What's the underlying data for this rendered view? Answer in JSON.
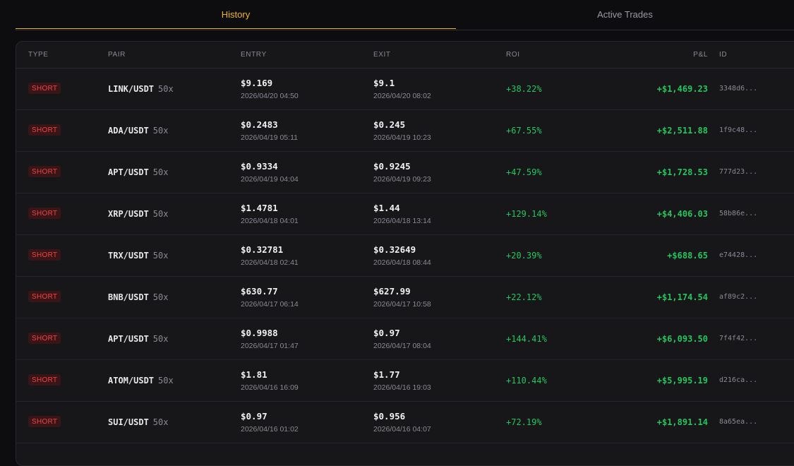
{
  "tabs": [
    {
      "label": "History",
      "active": true
    },
    {
      "label": "Active Trades",
      "active": false
    }
  ],
  "columns": {
    "type": "TYPE",
    "pair": "PAIR",
    "entry": "ENTRY",
    "exit": "EXIT",
    "roi": "ROI",
    "pnl": "P&L",
    "id": "ID"
  },
  "colors": {
    "accent": "#f0b429",
    "short": "#ef4444",
    "profit": "#22c55e"
  },
  "trades": [
    {
      "type": "SHORT",
      "pair": "LINK/USDT",
      "leverage": "50x",
      "entry_price": "$9.169",
      "entry_time": "2026/04/20 04:50",
      "exit_price": "$9.1",
      "exit_time": "2026/04/20 08:02",
      "roi": "+38.22%",
      "pnl": "+$1,469.23",
      "id": "3348d6..."
    },
    {
      "type": "SHORT",
      "pair": "ADA/USDT",
      "leverage": "50x",
      "entry_price": "$0.2483",
      "entry_time": "2026/04/19 05:11",
      "exit_price": "$0.245",
      "exit_time": "2026/04/19 10:23",
      "roi": "+67.55%",
      "pnl": "+$2,511.88",
      "id": "1f9c48..."
    },
    {
      "type": "SHORT",
      "pair": "APT/USDT",
      "leverage": "50x",
      "entry_price": "$0.9334",
      "entry_time": "2026/04/19 04:04",
      "exit_price": "$0.9245",
      "exit_time": "2026/04/19 09:23",
      "roi": "+47.59%",
      "pnl": "+$1,728.53",
      "id": "777d23..."
    },
    {
      "type": "SHORT",
      "pair": "XRP/USDT",
      "leverage": "50x",
      "entry_price": "$1.4781",
      "entry_time": "2026/04/18 04:01",
      "exit_price": "$1.44",
      "exit_time": "2026/04/18 13:14",
      "roi": "+129.14%",
      "pnl": "+$4,406.03",
      "id": "58b86e..."
    },
    {
      "type": "SHORT",
      "pair": "TRX/USDT",
      "leverage": "50x",
      "entry_price": "$0.32781",
      "entry_time": "2026/04/18 02:41",
      "exit_price": "$0.32649",
      "exit_time": "2026/04/18 08:44",
      "roi": "+20.39%",
      "pnl": "+$688.65",
      "id": "e74428..."
    },
    {
      "type": "SHORT",
      "pair": "BNB/USDT",
      "leverage": "50x",
      "entry_price": "$630.77",
      "entry_time": "2026/04/17 06:14",
      "exit_price": "$627.99",
      "exit_time": "2026/04/17 10:58",
      "roi": "+22.12%",
      "pnl": "+$1,174.54",
      "id": "af89c2..."
    },
    {
      "type": "SHORT",
      "pair": "APT/USDT",
      "leverage": "50x",
      "entry_price": "$0.9988",
      "entry_time": "2026/04/17 01:47",
      "exit_price": "$0.97",
      "exit_time": "2026/04/17 08:04",
      "roi": "+144.41%",
      "pnl": "+$6,093.50",
      "id": "7f4f42..."
    },
    {
      "type": "SHORT",
      "pair": "ATOM/USDT",
      "leverage": "50x",
      "entry_price": "$1.81",
      "entry_time": "2026/04/16 16:09",
      "exit_price": "$1.77",
      "exit_time": "2026/04/16 19:03",
      "roi": "+110.44%",
      "pnl": "+$5,995.19",
      "id": "d216ca..."
    },
    {
      "type": "SHORT",
      "pair": "SUI/USDT",
      "leverage": "50x",
      "entry_price": "$0.97",
      "entry_time": "2026/04/16 01:02",
      "exit_price": "$0.956",
      "exit_time": "2026/04/16 04:07",
      "roi": "+72.19%",
      "pnl": "+$1,891.14",
      "id": "8a65ea..."
    }
  ]
}
